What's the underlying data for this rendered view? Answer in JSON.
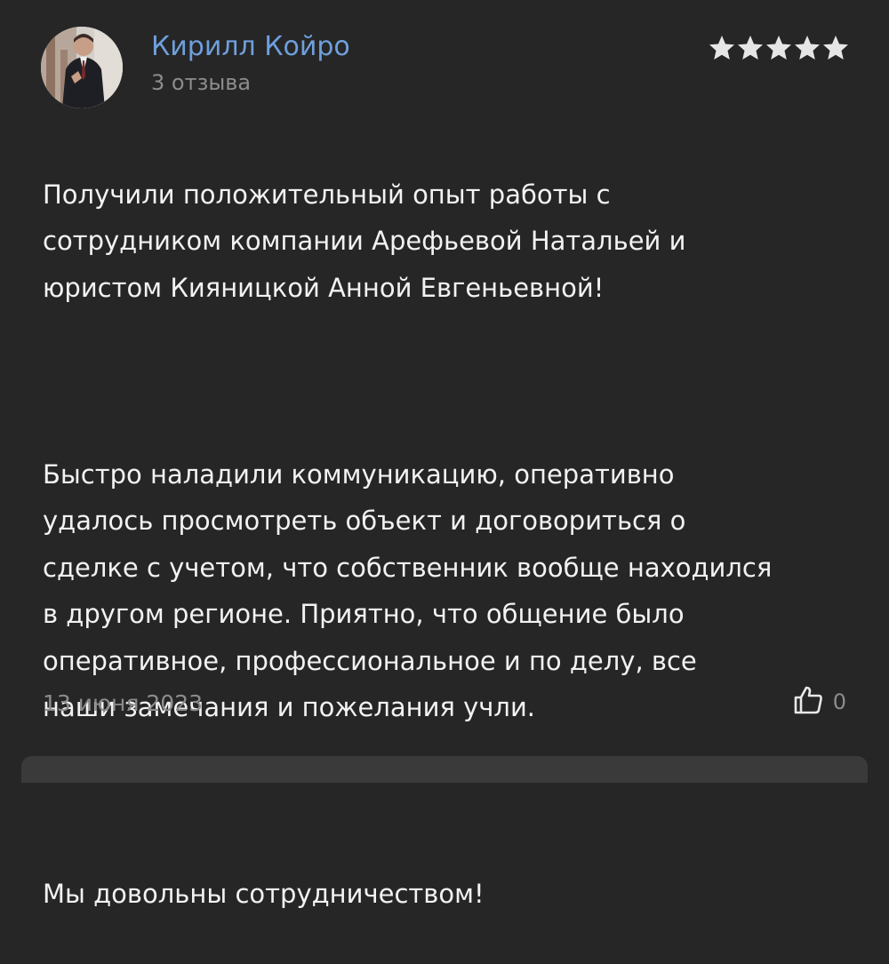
{
  "review": {
    "author_name": "Кирилл Койро",
    "author_reviews": "3 отзыва",
    "rating": 5,
    "rating_max": 5,
    "star_color": "#e6e6e6",
    "paragraph_1": "Получили положительный опыт работы с\nсотрудником компании Арефьевой Натальей и\nюристом Кияницкой Анной Евгеньевной!",
    "paragraph_2": "Быстро наладили коммуникацию, оперативно\nудалось просмотреть объект и договориться о\nсделке с учетом, что собственник вообще находился\nв другом регионе. Приятно, что общение было\nоперативное, профессиональное и по делу, все\nнаши замечания и пожелания учли.",
    "paragraph_3": "Мы довольны сотрудничеством!",
    "date": "13 июня 2023",
    "likes": "0",
    "like_icon": "thumbs-up-icon",
    "author_color": "#6f9fdc"
  }
}
